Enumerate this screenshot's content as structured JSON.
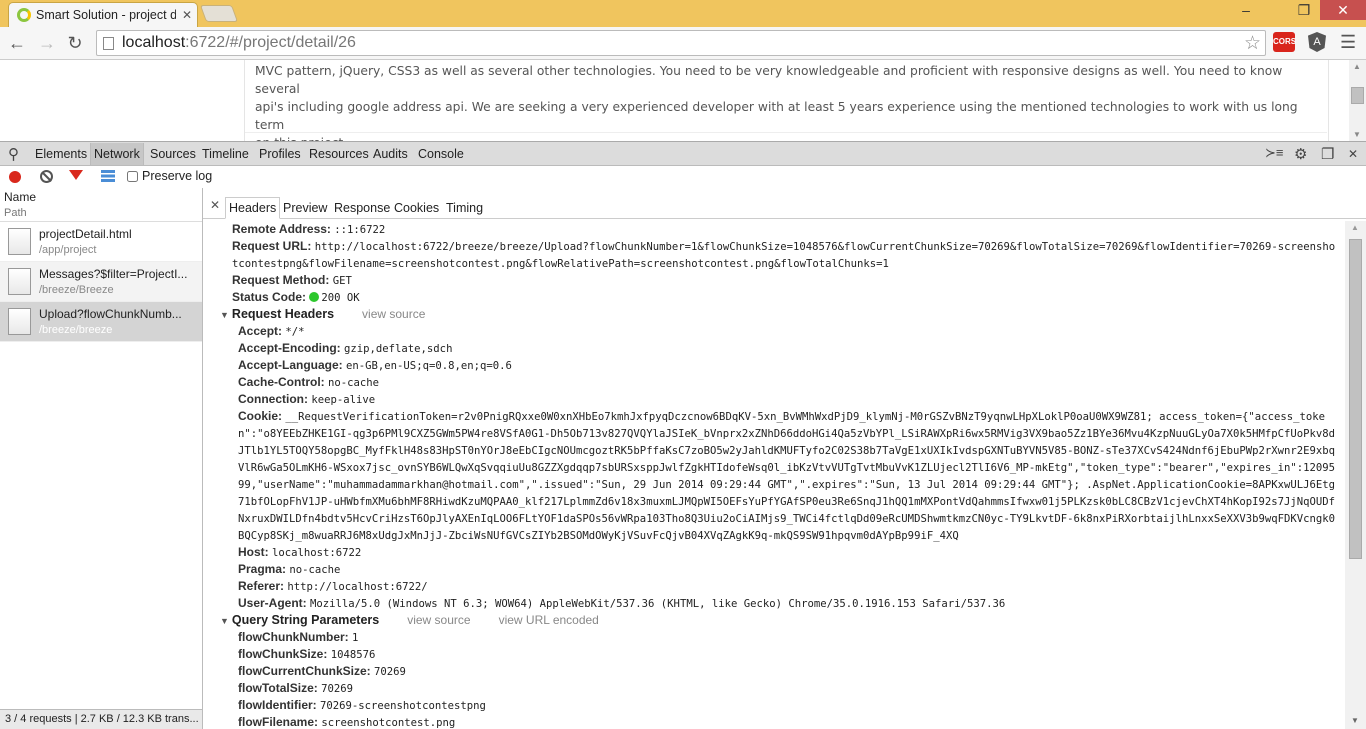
{
  "browser": {
    "tab_title": "Smart Solution - project d",
    "url_host": "localhost",
    "url_rest": ":6722/#/project/detail/26",
    "extensions": [
      "CORS",
      "A"
    ]
  },
  "page": {
    "description_lines": [
      "MVC pattern, jQuery, CSS3 as well as several other technologies. You need to be very knowledgeable and proficient with responsive designs as well. You need to know several",
      "api's including google address api. We are seeking a very experienced developer with at least 5 years experience using the mentioned technologies to work with us long term",
      "on this project."
    ]
  },
  "devtools": {
    "tabs": [
      "Elements",
      "Network",
      "Sources",
      "Timeline",
      "Profiles",
      "Resources",
      "Audits",
      "Console"
    ],
    "active_tab": "Network",
    "preserve_log_label": "Preserve log",
    "list_header": {
      "name": "Name",
      "path": "Path"
    },
    "requests": [
      {
        "name": "projectDetail.html",
        "path": "/app/project"
      },
      {
        "name": "Messages?$filter=ProjectI...",
        "path": "/breeze/Breeze"
      },
      {
        "name": "Upload?flowChunkNumb...",
        "path": "/breeze/breeze"
      }
    ],
    "status_footer": "3 / 4 requests | 2.7 KB / 12.3 KB trans...",
    "detail_tabs": [
      "Headers",
      "Preview",
      "Response",
      "Cookies",
      "Timing"
    ],
    "general": [
      {
        "key": "Remote Address:",
        "value": "::1:6722"
      },
      {
        "key": "Request URL:",
        "value": "http://localhost:6722/breeze/breeze/Upload?flowChunkNumber=1&flowChunkSize=1048576&flowCurrentChunkSize=70269&flowTotalSize=70269&flowIdentifier=70269-screenshotcontestpng&flowFilename=screenshotcontest.png&flowRelativePath=screenshotcontest.png&flowTotalChunks=1"
      },
      {
        "key": "Request Method:",
        "value": "GET"
      },
      {
        "key": "Status Code:",
        "value": "200 OK"
      }
    ],
    "request_headers_title": "Request Headers",
    "view_source": "view source",
    "view_url_encoded": "view URL encoded",
    "request_headers": [
      {
        "key": "Accept:",
        "value": "*/*"
      },
      {
        "key": "Accept-Encoding:",
        "value": "gzip,deflate,sdch"
      },
      {
        "key": "Accept-Language:",
        "value": "en-GB,en-US;q=0.8,en;q=0.6"
      },
      {
        "key": "Cache-Control:",
        "value": "no-cache"
      },
      {
        "key": "Connection:",
        "value": "keep-alive"
      },
      {
        "key": "Cookie:",
        "value": "__RequestVerificationToken=r2v0PnigRQxxe0W0xnXHbEo7kmhJxfpyqDczcnow6BDqKV-5xn_BvWMhWxdPjD9_klymNj-M0rGSZvBNzT9yqnwLHpXLoklP0oaU0WX9WZ81; access_token={\"access_token\":\"o8YEEbZHKE1GI-qg3p6PMl9CXZ5GWm5PW4re8VSfA0G1-Dh5Ob713v827QVQYlaJSIeK_bVnprx2xZNhD66ddoHGi4Qa5zVbYPl_LSiRAWXpRi6wx5RMVig3VX9bao5Zz1BYe36Mvu4KzpNuuGLyOa7X0k5HMfpCfUoPkv8dJTlb1YL5TOQY58opgBC_MyfFklH48s83HpST0nYOrJ8eEbCIgcNOUmcgoztRK5bPffaKsC7zoBO5w2yJahldKMUFTyfo2C02S38b7TaVgE1xUXIkIvdspGXNTuBYVN5V85-BONZ-sTe37XCvS424Ndnf6jEbuPWp2rXwnr2E9xbqVlR6wGa5OLmKH6-WSxox7jsc_ovnSYB6WLQwXqSvqqiuUu8GZZXgdqqp7sbURSxsppJwlfZgkHTIdofeWsq0l_ibKzVtvVUTgTvtMbuVvK1ZLUjecl2TlI6V6_MP-mkEtg\",\"token_type\":\"bearer\",\"expires_in\":1209599,\"userName\":\"muhammadammarkhan@hotmail.com\",\".issued\":\"Sun, 29 Jun 2014 09:29:44 GMT\",\".expires\":\"Sun, 13 Jul 2014 09:29:44 GMT\"}; .AspNet.ApplicationCookie=8APKxwULJ6Etg71bfOLopFhV1JP-uHWbfmXMu6bhMF8RHiwdKzuMQPAA0_klf217LplmmZd6v18x3muxmLJMQpWI5OEFsYuPfYGAfSP0eu3Re6SnqJ1hQQ1mMXPontVdQahmmsIfwxw01j5PLKzsk0bLC8CBzV1cjevChXT4hKopI92s7JjNqOUDfNxruxDWILDfn4bdtv5HcvCriHzsT6OpJlyAXEnIqLOO6FLtYOF1daSPOs56vWRpa103Tho8Q3Uiu2oCiAIMjs9_TWCi4fctlqDd09eRcUMDShwmtkmzCN0yc-TY9LkvtDF-6k8nxPiRXorbtaijlhLnxxSeXXV3b9wqFDKVcngk0BQCyp8SKj_m8wuaRRJ6M8xUdgJxMnJjJ-ZbciWsNUfGVCsZIYb2BSOMdOWyKjVSuvFcQjvB04XVqZAgkK9q-mkQS9SW91hpqvm0dAYpBp99iF_4XQ"
      },
      {
        "key": "Host:",
        "value": "localhost:6722"
      },
      {
        "key": "Pragma:",
        "value": "no-cache"
      },
      {
        "key": "Referer:",
        "value": "http://localhost:6722/"
      },
      {
        "key": "User-Agent:",
        "value": "Mozilla/5.0 (Windows NT 6.3; WOW64) AppleWebKit/537.36 (KHTML, like Gecko) Chrome/35.0.1916.153 Safari/537.36"
      }
    ],
    "query_params_title": "Query String Parameters",
    "query_params": [
      {
        "key": "flowChunkNumber:",
        "value": "1"
      },
      {
        "key": "flowChunkSize:",
        "value": "1048576"
      },
      {
        "key": "flowCurrentChunkSize:",
        "value": "70269"
      },
      {
        "key": "flowTotalSize:",
        "value": "70269"
      },
      {
        "key": "flowIdentifier:",
        "value": "70269-screenshotcontestpng"
      },
      {
        "key": "flowFilename:",
        "value": "screenshotcontest.png"
      }
    ],
    "colors": {
      "status_ok": "#2dc72d",
      "record": "#d9281c",
      "filter": "#d9281c"
    }
  }
}
